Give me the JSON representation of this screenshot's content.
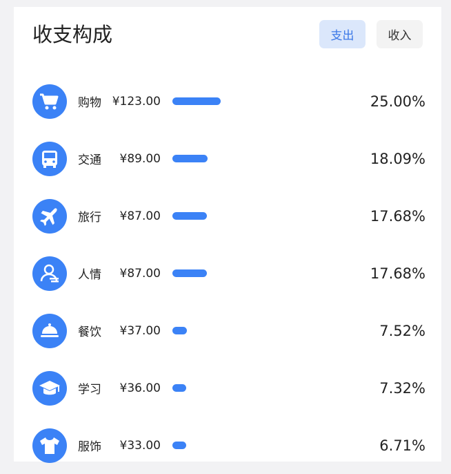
{
  "header": {
    "title": "收支构成",
    "tabs": [
      {
        "label": "支出",
        "active": true
      },
      {
        "label": "收入",
        "active": false
      }
    ]
  },
  "colors": {
    "accent": "#3b82f6",
    "tab_active_bg": "#dbe7fb",
    "tab_active_text": "#3b78e7"
  },
  "items": [
    {
      "icon": "shopping-cart-icon",
      "name": "购物",
      "amount": "¥123.00",
      "percent": "25.00%",
      "ratio": 0.25
    },
    {
      "icon": "bus-icon",
      "name": "交通",
      "amount": "¥89.00",
      "percent": "18.09%",
      "ratio": 0.1809
    },
    {
      "icon": "airplane-icon",
      "name": "旅行",
      "amount": "¥87.00",
      "percent": "17.68%",
      "ratio": 0.1768
    },
    {
      "icon": "person-hand-icon",
      "name": "人情",
      "amount": "¥87.00",
      "percent": "17.68%",
      "ratio": 0.1768
    },
    {
      "icon": "food-cloche-icon",
      "name": "餐饮",
      "amount": "¥37.00",
      "percent": "7.52%",
      "ratio": 0.0752
    },
    {
      "icon": "graduation-cap-icon",
      "name": "学习",
      "amount": "¥36.00",
      "percent": "7.32%",
      "ratio": 0.0732
    },
    {
      "icon": "tshirt-icon",
      "name": "服饰",
      "amount": "¥33.00",
      "percent": "6.71%",
      "ratio": 0.0671
    }
  ]
}
